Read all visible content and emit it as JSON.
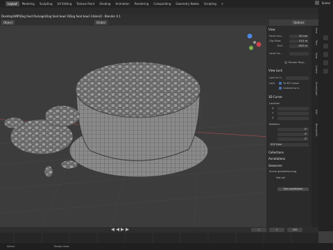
{
  "app": {
    "title": "Desktop\\WIP\\Dog food Package\\Dog food bowl 3\\Dog food bowl 3.blend] - Blender 4.1"
  },
  "menubar": {
    "tabs": [
      "Layout",
      "Modeling",
      "Sculpting",
      "UV Editing",
      "Texture Paint",
      "Shading",
      "Animation",
      "Rendering",
      "Compositing",
      "Geometry Nodes",
      "Scripting",
      "+"
    ],
    "active_index": 0
  },
  "topright": {
    "scene_label": "Scene"
  },
  "header": {
    "mode": "Object",
    "view": "Global",
    "options": "Options"
  },
  "npanel": {
    "view_section": "View",
    "focal_length_label": "Focal Len...",
    "focal_length_value": "50 mm",
    "clip_start_label": "Clip Start",
    "clip_start_value": "0.01 m",
    "clip_end_label": "End",
    "clip_end_value": "1000 m",
    "local_camera_label": "Local Ca...",
    "render_region_label": "Render Regi...",
    "view_lock_section": "View Lock",
    "lock_to_object_label": "Lock to O...",
    "lock_label": "Lock",
    "to_3d_cursor": "To 3D Cursor",
    "camera_to_view": "Camera to V...",
    "cursor_section": "3D Cursor",
    "location_label": "Location",
    "x_label": "X",
    "x_value": "",
    "y_label": "Y",
    "y_value": "",
    "z_label": "Z",
    "z_value": "",
    "rotation_label": "Rotation",
    "rx_value": "0°",
    "ry_value": "0°",
    "rz_value": "0°",
    "rotation_mode": "XYZ Euler",
    "collections_section": "Collections",
    "annotations_section": "Annotations",
    "georeferencing_section": "Geoscene",
    "geo_label": "Scene georeferencing",
    "geo_status": "Not set",
    "geo_button": "Geo coordinates"
  },
  "ntabs": [
    "Item",
    "Tool",
    "View",
    "Create",
    "Screencast",
    "Edit",
    "BlenderKit"
  ],
  "timeline": {
    "current_frame": "1",
    "start_frame": "1",
    "end_frame": "250"
  },
  "statusbar": {
    "left": "Select",
    "mid": "Rotate View"
  },
  "colors": {
    "accent": "#4772b3",
    "bg": "#3d3d3d",
    "panel": "#2b2b2b"
  }
}
